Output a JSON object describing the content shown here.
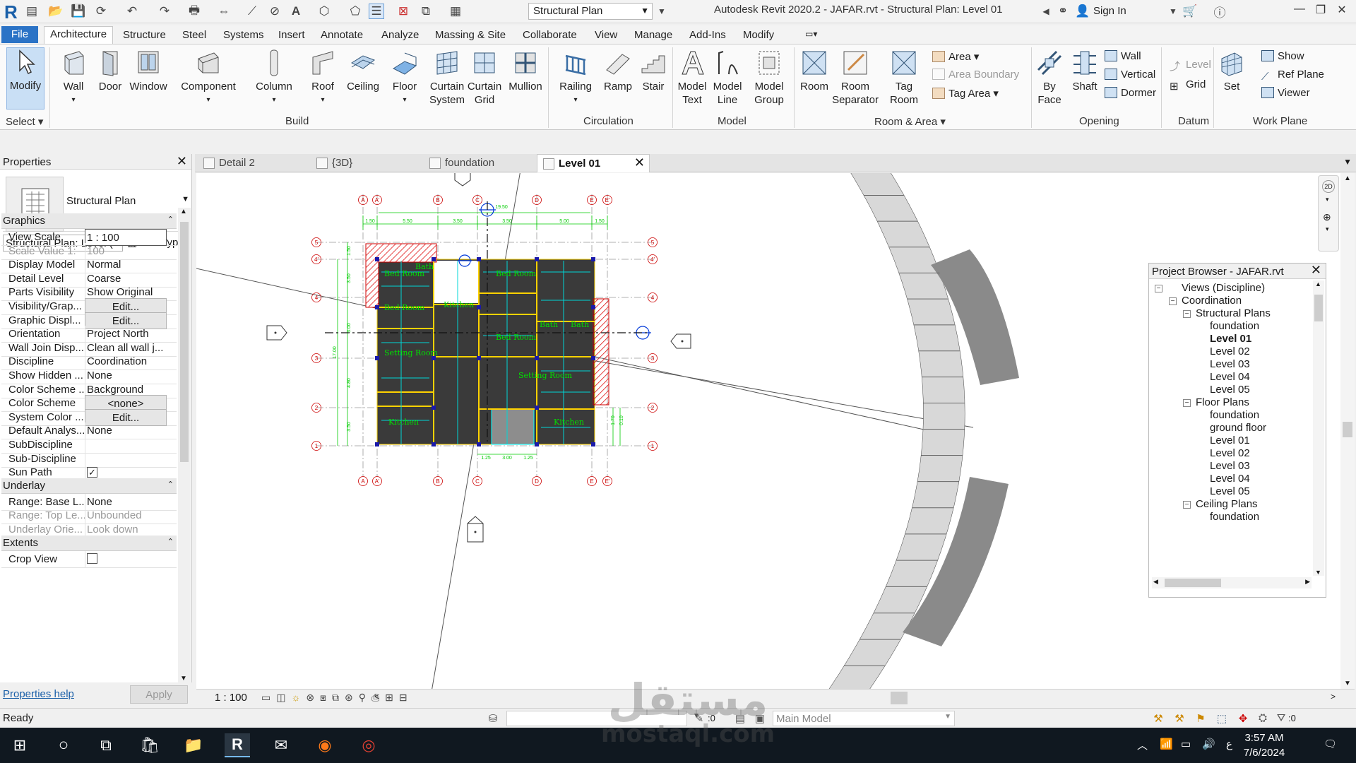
{
  "window": {
    "title": "Autodesk Revit 2020.2 - JAFAR.rvt - Structural Plan: Level 01",
    "view_combo": "Structural Plan",
    "sign_in": "Sign In"
  },
  "ribbon_tabs": [
    "File",
    "Architecture",
    "Structure",
    "Steel",
    "Systems",
    "Insert",
    "Annotate",
    "Analyze",
    "Massing & Site",
    "Collaborate",
    "View",
    "Manage",
    "Add-Ins",
    "Modify"
  ],
  "active_tab": "Architecture",
  "ribbon": {
    "select": {
      "modify": "Modify",
      "panel": "Select"
    },
    "build": {
      "wall": "Wall",
      "door": "Door",
      "window": "Window",
      "component": "Component",
      "column": "Column",
      "roof": "Roof",
      "ceiling": "Ceiling",
      "floor": "Floor",
      "curtain_system_1": "Curtain",
      "curtain_system_2": "System",
      "curtain_grid_1": "Curtain",
      "curtain_grid_2": "Grid",
      "mullion": "Mullion",
      "panel": "Build"
    },
    "circulation": {
      "railing": "Railing",
      "ramp": "Ramp",
      "stair": "Stair",
      "panel": "Circulation"
    },
    "model": {
      "model_text_1": "Model",
      "model_text_2": "Text",
      "model_line_1": "Model",
      "model_line_2": "Line",
      "model_group_1": "Model",
      "model_group_2": "Group",
      "panel": "Model"
    },
    "room_area": {
      "room": "Room",
      "room_sep_1": "Room",
      "room_sep_2": "Separator",
      "tag_room_1": "Tag",
      "tag_room_2": "Room",
      "area": "Area",
      "area_boundary": "Area  Boundary",
      "tag_area": "Tag  Area",
      "panel": "Room & Area"
    },
    "opening": {
      "by_face_1": "By",
      "by_face_2": "Face",
      "shaft": "Shaft",
      "wall": "Wall",
      "vertical": "Vertical",
      "dormer": "Dormer",
      "panel": "Opening"
    },
    "datum": {
      "level": "Level",
      "grid": "Grid",
      "panel": "Datum"
    },
    "work_plane": {
      "set": "Set",
      "show": "Show",
      "ref_plane": "Ref  Plane",
      "viewer": "Viewer",
      "panel": "Work Plane"
    }
  },
  "properties": {
    "title": "Properties",
    "type_name": "Structural Plan",
    "instance_combo": "Structural Plan: Level (",
    "edit_type": "Edit Type",
    "groups": [
      "Graphics",
      "Underlay",
      "Extents"
    ],
    "graphics_rows": [
      {
        "key": "View Scale",
        "value": "1 : 100"
      },
      {
        "key": "Scale Value    1:",
        "value": "100"
      },
      {
        "key": "Display Model",
        "value": "Normal"
      },
      {
        "key": "Detail Level",
        "value": "Coarse"
      },
      {
        "key": "Parts Visibility",
        "value": "Show Original"
      },
      {
        "key": "Visibility/Grap...",
        "value": "Edit..."
      },
      {
        "key": "Graphic Displ...",
        "value": "Edit..."
      },
      {
        "key": "Orientation",
        "value": "Project North"
      },
      {
        "key": "Wall Join Disp...",
        "value": "Clean all wall j..."
      },
      {
        "key": "Discipline",
        "value": "Coordination"
      },
      {
        "key": "Show Hidden ...",
        "value": "None"
      },
      {
        "key": "Color Scheme ...",
        "value": "Background"
      },
      {
        "key": "Color Scheme",
        "value": "<none>"
      },
      {
        "key": "System Color ...",
        "value": "Edit..."
      },
      {
        "key": "Default Analys...",
        "value": "None"
      },
      {
        "key": "SubDiscipline",
        "value": ""
      },
      {
        "key": "Sub-Discipline",
        "value": ""
      },
      {
        "key": "Sun Path",
        "value": ""
      }
    ],
    "underlay_rows": [
      {
        "key": "Range: Base L...",
        "value": "None"
      },
      {
        "key": "Range: Top Le...",
        "value": "Unbounded"
      },
      {
        "key": "Underlay Orie...",
        "value": "Look down"
      }
    ],
    "extents_rows": [
      {
        "key": "Crop View",
        "value": ""
      }
    ],
    "sun_path_checked": true,
    "crop_view_checked": false,
    "help": "Properties help",
    "apply": "Apply"
  },
  "view_tabs": [
    {
      "label": "Detail 2",
      "active": false
    },
    {
      "label": "{3D}",
      "active": false
    },
    {
      "label": "foundation",
      "active": false
    },
    {
      "label": "Level 01",
      "active": true
    }
  ],
  "drawing": {
    "grid_letters": [
      "A",
      "A'",
      "B",
      "C",
      "D",
      "E",
      "E'"
    ],
    "grid_numbers": [
      "5",
      "4'",
      "4",
      "3",
      "2",
      "1"
    ],
    "top_dims": [
      "1.50",
      "5.50",
      "3.50",
      "3.50",
      "5.00",
      "1.50"
    ],
    "bottom_dims": [
      "1.25",
      "3.00",
      "1.25"
    ],
    "left_dims": [
      "1.50",
      "3.50",
      "3.00",
      "4.80",
      "3.50"
    ],
    "left_total": "17.00",
    "right_dims": [
      "1.70",
      "0.10"
    ],
    "top_extra": "19.50",
    "rooms": [
      "Bed Room",
      "Bath",
      "Bed Room",
      "Kitchen",
      "Bed Room",
      "Bed Room",
      "Bath",
      "Bath",
      "Setting Room",
      "Setting Room",
      "Kitchen",
      "Kitchen"
    ]
  },
  "browser": {
    "title": "Project Browser - JAFAR.rvt",
    "nodes": [
      {
        "label": "Views (Discipline)",
        "level": 0,
        "toggle": "-"
      },
      {
        "label": "Coordination",
        "level": 1,
        "toggle": "-"
      },
      {
        "label": "Structural Plans",
        "level": 2,
        "toggle": "-"
      },
      {
        "label": "foundation",
        "level": 3,
        "toggle": ""
      },
      {
        "label": "Level 01",
        "level": 3,
        "toggle": "",
        "bold": true
      },
      {
        "label": "Level 02",
        "level": 3,
        "toggle": ""
      },
      {
        "label": "Level 03",
        "level": 3,
        "toggle": ""
      },
      {
        "label": "Level 04",
        "level": 3,
        "toggle": ""
      },
      {
        "label": "Level 05",
        "level": 3,
        "toggle": ""
      },
      {
        "label": "Floor Plans",
        "level": 2,
        "toggle": "-"
      },
      {
        "label": "foundation",
        "level": 3,
        "toggle": ""
      },
      {
        "label": "ground floor",
        "level": 3,
        "toggle": ""
      },
      {
        "label": "Level 01",
        "level": 3,
        "toggle": ""
      },
      {
        "label": "Level 02",
        "level": 3,
        "toggle": ""
      },
      {
        "label": "Level 03",
        "level": 3,
        "toggle": ""
      },
      {
        "label": "Level 04",
        "level": 3,
        "toggle": ""
      },
      {
        "label": "Level 05",
        "level": 3,
        "toggle": ""
      },
      {
        "label": "Ceiling Plans",
        "level": 2,
        "toggle": "-"
      },
      {
        "label": "foundation",
        "level": 3,
        "toggle": ""
      }
    ]
  },
  "view_control": {
    "scale": "1 : 100"
  },
  "status": {
    "text": "Ready",
    "selection_count": ":0",
    "model": "Main Model",
    "filter_count": ":0"
  },
  "taskbar": {
    "time": "3:57 AM",
    "date": "7/6/2024",
    "lang": "ع"
  },
  "watermark": {
    "arabic": "مستقل",
    "latin": "mostaql.com"
  }
}
